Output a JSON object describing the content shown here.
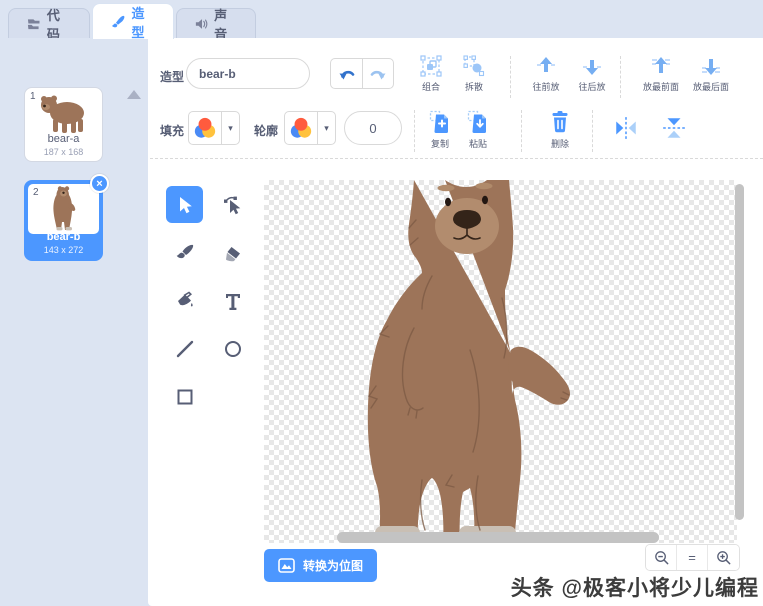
{
  "tabs": [
    {
      "label": "代码"
    },
    {
      "label": "造型"
    },
    {
      "label": "声音"
    }
  ],
  "sidebar": {
    "costumes": [
      {
        "index": "1",
        "name": "bear-a",
        "size": "187 x 168",
        "selected": false
      },
      {
        "index": "2",
        "name": "bear-b",
        "size": "143 x 272",
        "selected": true
      }
    ],
    "close_glyph": "×"
  },
  "toolbar": {
    "costume_label": "造型",
    "costume_name": "bear-b",
    "group_label": "组合",
    "ungroup_label": "拆散",
    "forward_label": "往前放",
    "backward_label": "往后放",
    "front_label": "放最前面",
    "back_label": "放最后面",
    "fill_label": "填充",
    "outline_label": "轮廓",
    "outline_width": "0",
    "caret_glyph": "▾",
    "copy_label": "复制",
    "paste_label": "粘贴",
    "delete_label": "删除"
  },
  "canvas": {
    "convert_button": "转换为位图",
    "zoom_reset_glyph": "="
  },
  "watermark": "头条 @极客小将少儿编程",
  "colors": {
    "accent": "#4c97ff",
    "accent_dark": "#3373cc",
    "disabled_blue": "#9cc6f8",
    "panel_bg": "#dce4f2",
    "text": "#575e75",
    "bear_fur": "#9d7459",
    "bear_muzzle": "#b28c6e",
    "bear_nose": "#342419",
    "bear_cuff": "#c9bfb4",
    "swatch_orange": "#ff5b3e",
    "swatch_blue": "#4a8af5",
    "swatch_yellow": "#ffc23d"
  }
}
